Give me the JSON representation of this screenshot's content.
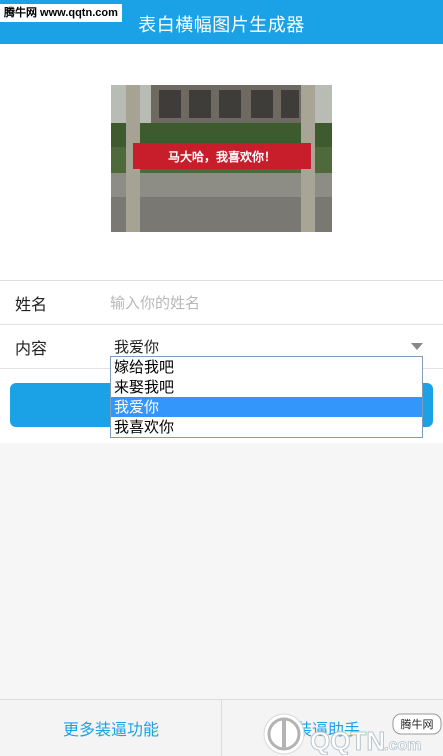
{
  "watermark": {
    "site": "腾牛网 www.qqtn.com",
    "logo_text": "QQTN",
    "logo_suffix": ".com",
    "badge": "腾牛网"
  },
  "header": {
    "title": "表白横幅图片生成器"
  },
  "preview": {
    "banner_text": "马大哈，我喜欢你！"
  },
  "form": {
    "name_label": "姓名",
    "name_placeholder": "输入你的姓名",
    "name_value": "",
    "content_label": "内容",
    "content_value": "我爱你",
    "options": [
      "嫁给我吧",
      "来娶我吧",
      "我爱你",
      "我喜欢你"
    ],
    "selected_index": 2
  },
  "footer": {
    "more_label": "更多装逼功能",
    "assistant_label": "装逼助手"
  },
  "colors": {
    "accent": "#1ba2e6",
    "banner_red": "#c81e2c",
    "option_highlight": "#3296fa"
  }
}
